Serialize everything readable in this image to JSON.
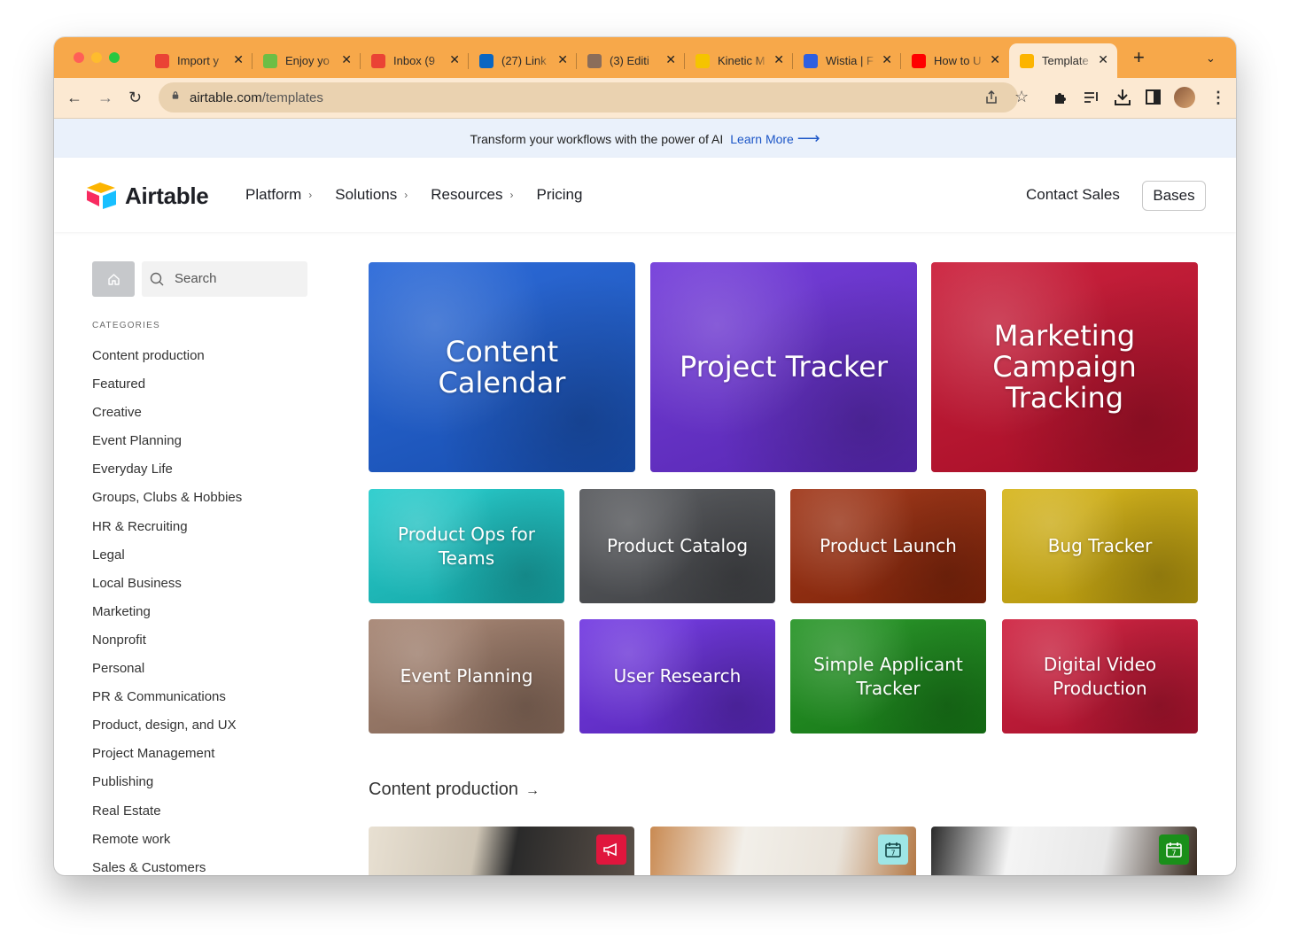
{
  "browser": {
    "tabs": [
      {
        "title": "Import y",
        "icon": "gmail-icon",
        "color": "#ea4335"
      },
      {
        "title": "Enjoy yo",
        "icon": "bhn-icon",
        "color": "#6dbe45"
      },
      {
        "title": "Inbox (9",
        "icon": "gmail-icon",
        "color": "#ea4335"
      },
      {
        "title": "(27) Link",
        "icon": "linkedin-icon",
        "color": "#0a66c2"
      },
      {
        "title": "(3) Editi",
        "icon": "profile-icon",
        "color": "#8a6d5a"
      },
      {
        "title": "Kinetic M",
        "icon": "kinetic-icon",
        "color": "#f5c400"
      },
      {
        "title": "Wistia | F",
        "icon": "wistia-icon",
        "color": "#2f5fe0"
      },
      {
        "title": "How to U",
        "icon": "youtube-icon",
        "color": "#ff0000"
      },
      {
        "title": "Template",
        "icon": "airtable-icon",
        "color": "#fcb400",
        "active": true
      }
    ],
    "url_host": "airtable.com",
    "url_path": "/templates"
  },
  "banner": {
    "text": "Transform your workflows with the power of AI",
    "link": "Learn More"
  },
  "header": {
    "brand": "Airtable",
    "nav": [
      {
        "label": "Platform",
        "has_chevron": true
      },
      {
        "label": "Solutions",
        "has_chevron": true
      },
      {
        "label": "Resources",
        "has_chevron": true
      },
      {
        "label": "Pricing",
        "has_chevron": false
      }
    ],
    "contact": "Contact Sales",
    "bases": "Bases"
  },
  "sidebar": {
    "search_placeholder": "Search",
    "categories_heading": "CATEGORIES",
    "categories": [
      "Content production",
      "Featured",
      "Creative",
      "Event Planning",
      "Everyday Life",
      "Groups, Clubs & Hobbies",
      "HR & Recruiting",
      "Legal",
      "Local Business",
      "Marketing",
      "Nonprofit",
      "Personal",
      "PR & Communications",
      "Product, design, and UX",
      "Project Management",
      "Publishing",
      "Real Estate",
      "Remote work",
      "Sales & Customers"
    ]
  },
  "featured": {
    "big": [
      {
        "title": "Content Calendar",
        "color": "#1c5fd6"
      },
      {
        "title": "Project Tracker",
        "color": "#6a2fd8"
      },
      {
        "title": "Marketing Campaign Tracking",
        "color": "#c8102e"
      }
    ],
    "row2": [
      {
        "title": "Product Ops for Teams",
        "color": "#19c9c9"
      },
      {
        "title": "Product Catalog",
        "color": "#4e5054"
      },
      {
        "title": "Product Launch",
        "color": "#9a2a0a"
      },
      {
        "title": "Bug Tracker",
        "color": "#d4b10e"
      }
    ],
    "row3": [
      {
        "title": "Event Planning",
        "color": "#a07d6a"
      },
      {
        "title": "User Research",
        "color": "#6a2ee0"
      },
      {
        "title": "Simple Applicant Tracker",
        "color": "#1a8f1a"
      },
      {
        "title": "Digital Video Production",
        "color": "#cc1535"
      }
    ]
  },
  "section": {
    "title": "Content production",
    "thumbs": [
      {
        "badge_icon": "megaphone-icon",
        "badge_color": "#e0163d"
      },
      {
        "badge_icon": "calendar-icon",
        "badge_color": "#9ee6e6"
      },
      {
        "badge_icon": "calendar-icon",
        "badge_color": "#1a8f1a"
      }
    ]
  }
}
